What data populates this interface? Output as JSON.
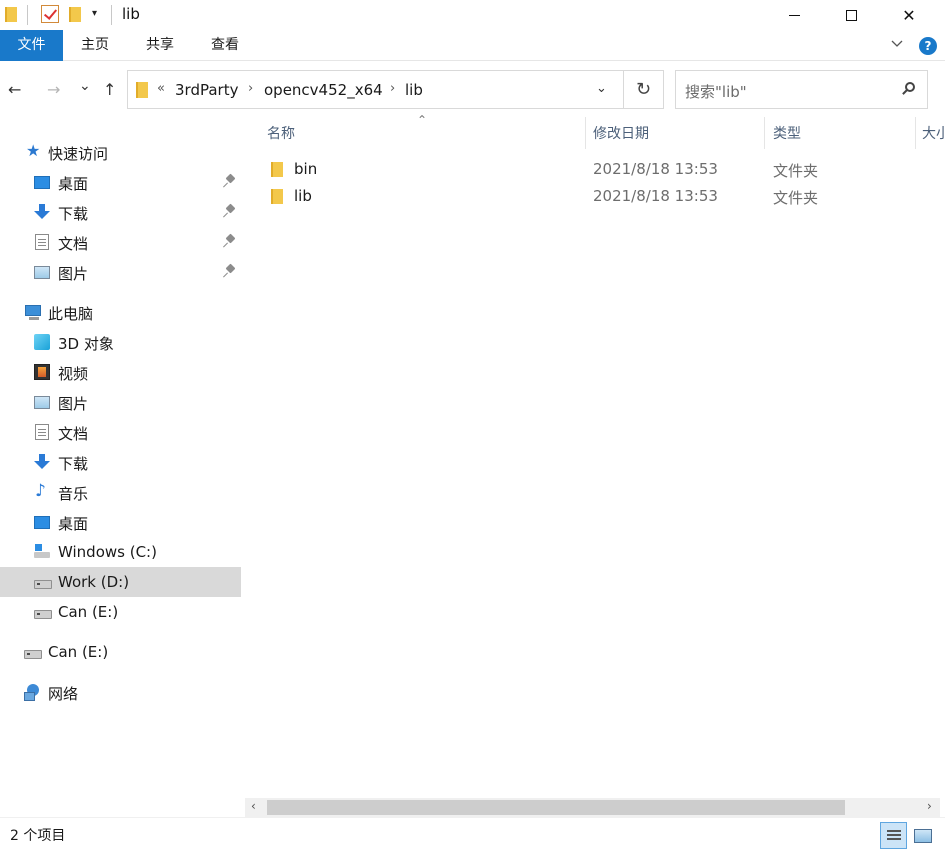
{
  "window": {
    "title": "lib",
    "minimize_glyph": "—",
    "maximize_glyph": "☐",
    "close_glyph": "✕",
    "dropdown_glyph": "▾"
  },
  "ribbon": {
    "tabs": [
      "文件",
      "主页",
      "共享",
      "查看"
    ],
    "help_glyph": "?"
  },
  "nav": {
    "back_glyph": "←",
    "forward_glyph": "→",
    "recent_glyph": "⌄",
    "up_glyph": "↑",
    "overflow_glyph": "«",
    "breadcrumbs": [
      "3rdParty",
      "opencv452_x64",
      "lib"
    ],
    "crumb_separator": "›",
    "address_dropdown_glyph": "⌄",
    "refresh_glyph": "↻",
    "search_placeholder": "搜索\"lib\""
  },
  "sidebar": {
    "quick_access": "快速访问",
    "quick_items": [
      {
        "label": "桌面",
        "icon": "desktop-icon"
      },
      {
        "label": "下载",
        "icon": "download-icon"
      },
      {
        "label": "文档",
        "icon": "document-icon"
      },
      {
        "label": "图片",
        "icon": "pictures-icon"
      }
    ],
    "this_pc": "此电脑",
    "pc_items": [
      {
        "label": "3D 对象",
        "icon": "3d-objects-icon"
      },
      {
        "label": "视频",
        "icon": "video-icon"
      },
      {
        "label": "图片",
        "icon": "pictures-icon"
      },
      {
        "label": "文档",
        "icon": "document-icon"
      },
      {
        "label": "下载",
        "icon": "download-icon"
      },
      {
        "label": "音乐",
        "icon": "music-icon"
      },
      {
        "label": "桌面",
        "icon": "desktop-icon"
      },
      {
        "label": "Windows (C:)",
        "icon": "windows-drive-icon"
      },
      {
        "label": "Work (D:)",
        "icon": "drive-icon",
        "selected": true
      },
      {
        "label": "Can (E:)",
        "icon": "drive-icon"
      }
    ],
    "extra_drive": "Can (E:)",
    "network": "网络"
  },
  "columns": {
    "name": "名称",
    "modified": "修改日期",
    "type": "类型",
    "size": "大小"
  },
  "files": [
    {
      "name": "bin",
      "modified": "2021/8/18 13:53",
      "type": "文件夹"
    },
    {
      "name": "lib",
      "modified": "2021/8/18 13:53",
      "type": "文件夹"
    }
  ],
  "status": {
    "item_count": "2 个项目"
  },
  "scrollbar": {
    "left_glyph": "‹",
    "right_glyph": "›"
  },
  "colors": {
    "accent": "#1979ca",
    "selected_row": "#d9d9d9",
    "folder": "#f3c84b"
  }
}
